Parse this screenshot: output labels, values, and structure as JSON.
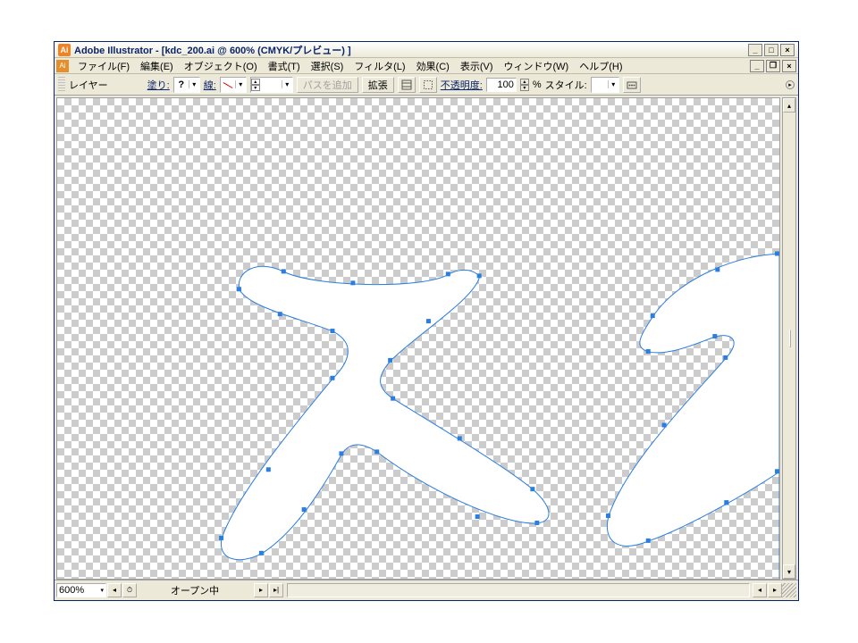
{
  "title": "Adobe Illustrator - [kdc_200.ai @ 600% (CMYK/プレビュー) ]",
  "menu": {
    "file": "ファイル(F)",
    "edit": "編集(E)",
    "object": "オブジェクト(O)",
    "type": "書式(T)",
    "select": "選択(S)",
    "filter": "フィルタ(L)",
    "effect": "効果(C)",
    "view": "表示(V)",
    "window": "ウィンドウ(W)",
    "help": "ヘルプ(H)"
  },
  "option_bar": {
    "label_layer": "レイヤー",
    "label_fill": "塗り:",
    "fill_value": "?",
    "label_stroke": "線:",
    "stroke_value": "none",
    "stroke_weight": "",
    "btn_addpath": "パスを追加",
    "btn_expand": "拡張",
    "label_opacity": "不透明度:",
    "opacity_value": "100",
    "opacity_unit": "%",
    "label_style": "スタイル:"
  },
  "status": {
    "zoom": "600%",
    "text": "オープン中"
  },
  "colors": {
    "selection": "#2a7de1",
    "anchor": "#2a7de1",
    "checker_light": "#ffffff",
    "checker_dark": "#cccccc",
    "ui_bg": "#ece9d8"
  }
}
